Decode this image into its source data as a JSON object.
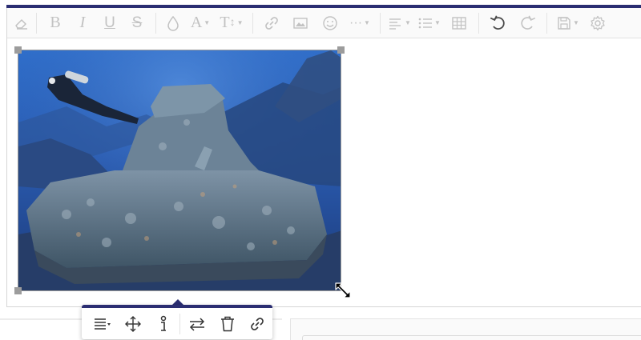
{
  "toolbar": {
    "buttons": [
      {
        "name": "eraser-icon",
        "state": "disabled"
      },
      {
        "name": "bold-icon",
        "label": "B",
        "state": "disabled"
      },
      {
        "name": "italic-icon",
        "label": "I",
        "state": "disabled"
      },
      {
        "name": "underline-icon",
        "label": "U",
        "state": "disabled"
      },
      {
        "name": "strikethrough-icon",
        "label": "S",
        "state": "disabled"
      },
      {
        "name": "color-drop-icon",
        "state": "disabled"
      },
      {
        "name": "font-icon",
        "label": "A",
        "state": "disabled"
      },
      {
        "name": "font-size-icon",
        "label": "T",
        "state": "disabled"
      },
      {
        "name": "link-icon",
        "state": "disabled"
      },
      {
        "name": "image-icon",
        "state": "disabled"
      },
      {
        "name": "emoji-icon",
        "state": "disabled"
      },
      {
        "name": "more-icon",
        "label": "···",
        "state": "disabled"
      },
      {
        "name": "align-icon",
        "state": "disabled"
      },
      {
        "name": "list-icon",
        "state": "disabled"
      },
      {
        "name": "table-icon",
        "state": "disabled"
      },
      {
        "name": "undo-icon",
        "state": "active"
      },
      {
        "name": "redo-icon",
        "state": "disabled"
      },
      {
        "name": "save-icon",
        "state": "disabled"
      },
      {
        "name": "settings-icon",
        "state": "disabled"
      }
    ]
  },
  "image": {
    "subject": "underwater-tank-wreck-with-diver",
    "selected": true
  },
  "image_popover": {
    "buttons": [
      {
        "name": "align-icon"
      },
      {
        "name": "move-icon"
      },
      {
        "name": "info-icon"
      },
      {
        "name": "replace-icon"
      },
      {
        "name": "delete-icon"
      },
      {
        "name": "link-icon"
      }
    ]
  },
  "colors": {
    "accent": "#2b2e72",
    "toolbar_bg": "#fafafa",
    "icon_disabled": "#c2c2c2",
    "icon_active": "#4a4a4a"
  }
}
